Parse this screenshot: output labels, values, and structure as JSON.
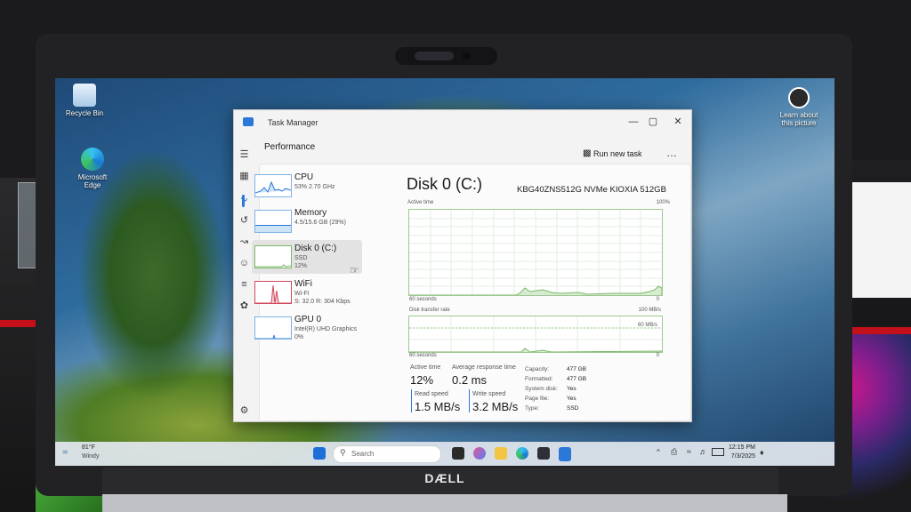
{
  "desktop": {
    "recycle_bin": "Recycle Bin",
    "edge_line1": "Microsoft",
    "edge_line2": "Edge",
    "learn_line1": "Learn about",
    "learn_line2": "this picture"
  },
  "window": {
    "title": "Task Manager",
    "min": "—",
    "max": "▢",
    "close": "✕"
  },
  "header": {
    "section": "Performance",
    "run_task": "Run new task",
    "more": "…"
  },
  "resources": [
    {
      "name": "CPU",
      "sub": "53% 2.70 GHz",
      "sub2": ""
    },
    {
      "name": "Memory",
      "sub": "4.5/15.6 GB (29%)",
      "sub2": ""
    },
    {
      "name": "Disk 0 (C:)",
      "sub": "SSD",
      "sub2": "12%"
    },
    {
      "name": "WiFi",
      "sub": "Wi-Fi",
      "sub2": "S: 32.0  R: 304 Kbps"
    },
    {
      "name": "GPU 0",
      "sub": "Intel(R) UHD Graphics",
      "sub2": "0%"
    }
  ],
  "detail": {
    "title": "Disk 0 (C:)",
    "model": "KBG40ZNS512G NVMe KIOXIA 512GB",
    "active_label": "Active time",
    "active_max": "100%",
    "active_foot_left": "60 seconds",
    "active_foot_right": "0",
    "transfer_label": "Disk transfer rate",
    "transfer_max": "100 MB/s",
    "transfer_mid": "60 MB/s",
    "transfer_foot_left": "60 seconds",
    "transfer_foot_right": "0"
  },
  "stats": {
    "active_time_label": "Active time",
    "active_time_value": "12%",
    "resp_label": "Average response time",
    "resp_value": "0.2 ms",
    "read_label": "Read speed",
    "read_value": "1.5 MB/s",
    "write_label": "Write speed",
    "write_value": "3.2 MB/s"
  },
  "props": [
    {
      "k": "Capacity:",
      "v": "477 GB"
    },
    {
      "k": "Formatted:",
      "v": "477 GB"
    },
    {
      "k": "System disk:",
      "v": "Yes"
    },
    {
      "k": "Page file:",
      "v": "Yes"
    },
    {
      "k": "Type:",
      "v": "SSD"
    }
  ],
  "taskbar": {
    "weather_temp": "81°F",
    "weather_desc": "Windy",
    "search_placeholder": "Search",
    "time": "12:15 PM",
    "date": "7/3/2025"
  },
  "brand": "DÆLL",
  "colors": {
    "accent": "#2b78d8",
    "disk_graph": "#7cb86a",
    "cpu_graph": "#2b78d8",
    "wifi_graph": "#d1475b"
  }
}
